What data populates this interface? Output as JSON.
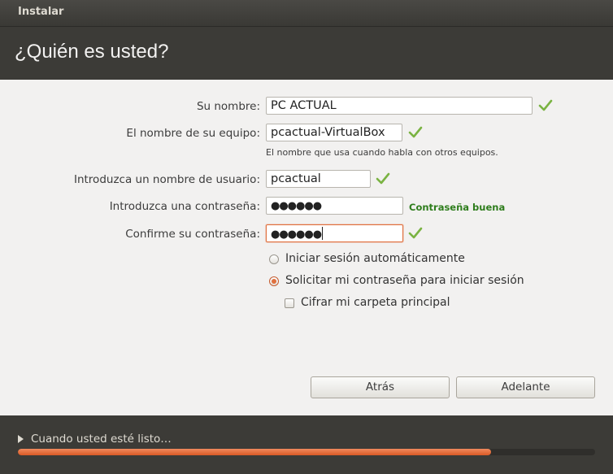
{
  "window": {
    "title": "Instalar"
  },
  "page": {
    "heading": "¿Quién es usted?"
  },
  "form": {
    "name_label": "Su nombre:",
    "name_value": "PC ACTUAL",
    "computer_label": "El nombre de su equipo:",
    "computer_value": "pcactual-VirtualBox",
    "computer_hint": "El nombre que usa cuando habla con otros equipos.",
    "username_label": "Introduzca un nombre de usuario:",
    "username_value": "pcactual",
    "password_label": "Introduzca una contraseña:",
    "password_value": "●●●●●●",
    "password_strength": "Contraseña buena",
    "confirm_label": "Confirme su contraseña:",
    "confirm_value": "●●●●●●"
  },
  "login_options": {
    "auto_login_label": "Iniciar sesión automáticamente",
    "auto_login_selected": false,
    "require_password_label": "Solicitar mi contraseña para iniciar sesión",
    "require_password_selected": true,
    "encrypt_home_label": "Cifrar mi carpeta principal",
    "encrypt_home_checked": false
  },
  "buttons": {
    "back": "Atrás",
    "forward": "Adelante"
  },
  "footer": {
    "status": "Cuando usted esté listo…",
    "progress": 0.82
  },
  "colors": {
    "accent": "#e0703e",
    "check": "#7ab342",
    "strength": "#2e7d1c"
  },
  "icons": {
    "valid": "check-icon",
    "expander": "triangle-right-icon"
  }
}
